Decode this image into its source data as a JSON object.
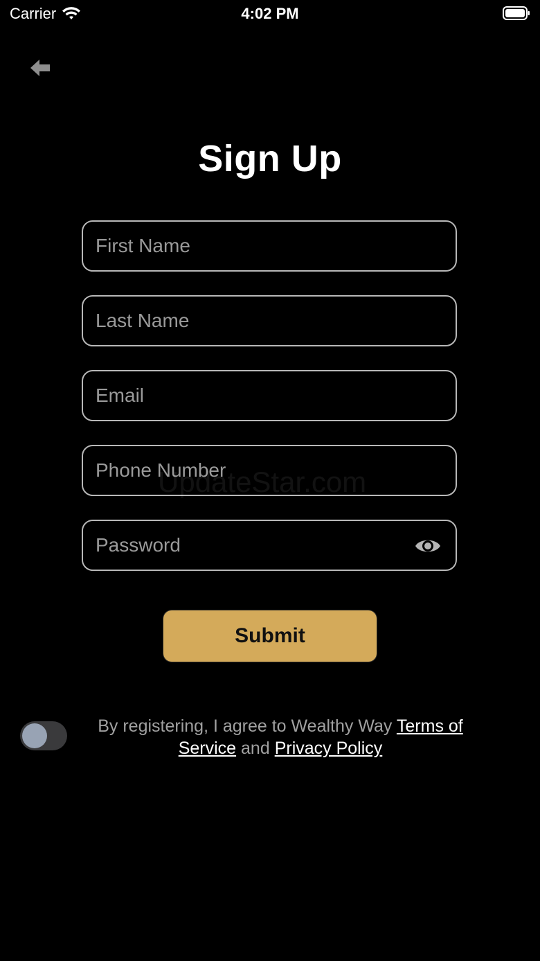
{
  "status_bar": {
    "carrier": "Carrier",
    "time": "4:02 PM",
    "wifi_icon": "wifi-icon",
    "battery_icon": "battery-full-icon"
  },
  "nav": {
    "back_icon": "arrow-left-icon"
  },
  "title": "Sign Up",
  "form": {
    "first_name": {
      "placeholder": "First Name",
      "value": ""
    },
    "last_name": {
      "placeholder": "Last Name",
      "value": ""
    },
    "email": {
      "placeholder": "Email",
      "value": ""
    },
    "phone": {
      "placeholder": "Phone Number",
      "value": ""
    },
    "password": {
      "placeholder": "Password",
      "value": "",
      "toggle_icon": "eye-icon"
    }
  },
  "watermark": "UpdateStar.com",
  "submit_label": "Submit",
  "agreement": {
    "toggle_on": false,
    "prefix": "By registering, I agree to Wealthy Way ",
    "terms_link": "Terms of Service",
    "connector": " and ",
    "privacy_link": "Privacy Policy"
  },
  "colors": {
    "background": "#000000",
    "accent": "#d4aa5a",
    "field_border": "#b8b8b8",
    "placeholder": "#9a9a9a"
  }
}
